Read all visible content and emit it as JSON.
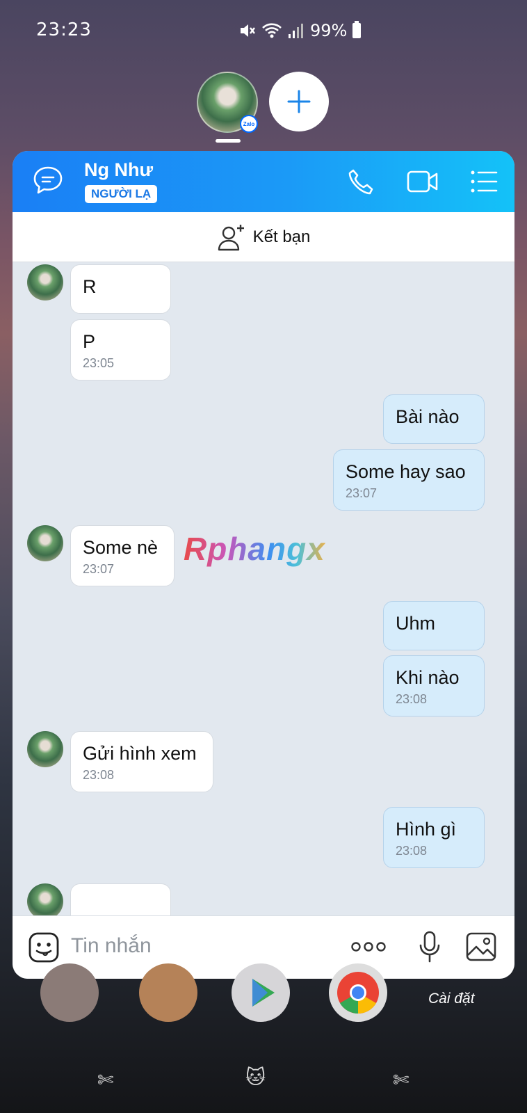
{
  "status_bar": {
    "time": "23:23",
    "battery": "99%"
  },
  "header": {
    "name": "Ng Như",
    "badge": "NGƯỜI LẠ"
  },
  "bubble": {
    "badge": "Zalo"
  },
  "friend_bar": {
    "label": "Kết bạn"
  },
  "messages": [
    {
      "side": "them",
      "text": "R",
      "time": ""
    },
    {
      "side": "them",
      "text": "P",
      "time": "23:05"
    },
    {
      "side": "me",
      "text": "Bài nào",
      "time": ""
    },
    {
      "side": "me",
      "text": "Some hay sao",
      "time": "23:07"
    },
    {
      "side": "them",
      "text": "Some nè",
      "time": "23:07"
    },
    {
      "side": "me",
      "text": "Uhm",
      "time": ""
    },
    {
      "side": "me",
      "text": "Khi nào",
      "time": "23:08"
    },
    {
      "side": "them",
      "text": "Gửi hình xem",
      "time": "23:08"
    },
    {
      "side": "me",
      "text": "Hình gì",
      "time": "23:08"
    }
  ],
  "watermark": "Rphangx",
  "input": {
    "placeholder": "Tin nhắn"
  },
  "home": {
    "settings_label": "Cài đặt"
  },
  "colors": {
    "header_start": "#1a7ff5",
    "header_end": "#14c2f8",
    "my_bubble": "#d6ecfb",
    "their_bubble": "#ffffff"
  }
}
